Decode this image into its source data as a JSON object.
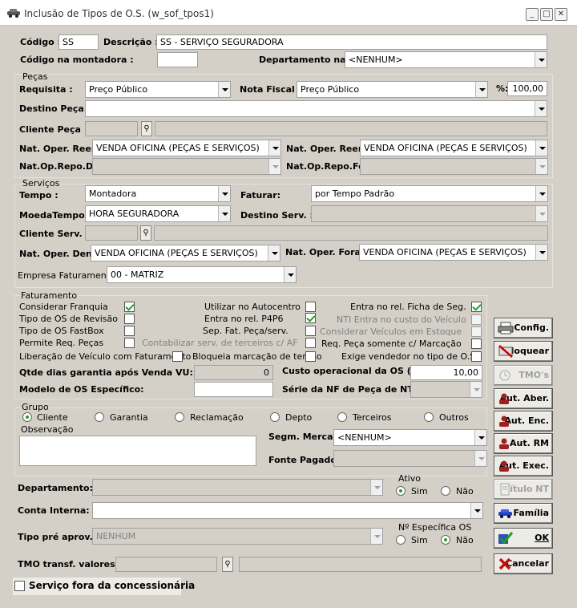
{
  "window": {
    "title": "Inclusão de Tipos de O.S. (w_sof_tpos1)",
    "min": "_",
    "max": "□",
    "close": "✕"
  },
  "codigo": {
    "label": "Código :",
    "value": "SS"
  },
  "descricao": {
    "label": "Descrição :",
    "value": "SS - SERVIÇO SEGURADORA"
  },
  "codigo_montadora": {
    "label": "Código na montadora :",
    "value": ""
  },
  "departamento_nf": {
    "label": "Departamento na NF:",
    "value": "<NENHUM>"
  },
  "pecas": {
    "group": "Peças",
    "requisita": {
      "label": "Requisita :",
      "value": "Preço Público"
    },
    "nota_fiscal": {
      "label": "Nota Fiscal :",
      "value": "Preço Público"
    },
    "percent": {
      "label": "%:",
      "value": "100,00"
    },
    "destino_peca": {
      "label": "Destino Peça :",
      "value": ""
    },
    "cliente_peca": {
      "label": "Cliente Peça :"
    },
    "nat_reem1": {
      "label": "Nat. Oper. Reem.",
      "value": "VENDA OFICINA (PEÇAS E SERVIÇOS)"
    },
    "nat_reem2": {
      "label": "Nat. Oper. Reem.",
      "value": "VENDA OFICINA (PEÇAS E SERVIÇOS)"
    },
    "nat_repo_den": {
      "label": "Nat.Op.Repo.Den:",
      "value": ""
    },
    "nat_repo_fora": {
      "label": "Nat.Op.Repo.Fora:",
      "value": ""
    }
  },
  "servicos": {
    "group": "Serviços",
    "tempo": {
      "label": "Tempo :",
      "value": "Montadora"
    },
    "faturar": {
      "label": "Faturar:",
      "value": "por Tempo Padrão"
    },
    "moeda": {
      "label": "MoedaTempo :",
      "value": "HORA SEGURADORA"
    },
    "destino_serv": {
      "label": "Destino Serv. :",
      "value": ""
    },
    "cliente_serv": {
      "label": "Cliente Serv. :"
    },
    "nat_dentro": {
      "label": "Nat. Oper. Dentro:",
      "value": "VENDA OFICINA (PEÇAS E SERVIÇOS)"
    },
    "nat_fora": {
      "label": "Nat. Oper. Fora:",
      "value": "VENDA OFICINA (PEÇAS E SERVIÇOS)"
    },
    "empresa": {
      "label": "Empresa Faturamento:",
      "value": "00 - MATRIZ"
    }
  },
  "faturamento": {
    "group": "Faturamento",
    "considerar_franquia": "Considerar Franquia",
    "tipo_revisao": "Tipo de OS de Revisão",
    "tipo_fastbox": "Tipo de OS FastBox",
    "permite_req": "Permite Req. Peças",
    "liberacao": "Liberação de Veículo com Faturamento",
    "autocentro": "Utilizar no Autocentro",
    "p4p6": "Entra no rel. P4P6",
    "sep_fat": "Sep. Fat. Peça/serv.",
    "contabilizar": "Contabilizar serv. de terceiros c/ AF",
    "bloqueia": "Bloqueia marcação de tempo",
    "ficha_seg": "Entra no rel. Ficha de Seg.",
    "nti_custo": "NTI Entra no custo do Veículo",
    "veic_estoque": "Considerar Veículos em Estoque",
    "req_peca": "Req. Peça somente c/ Marcação",
    "exige_vend": "Exige vendedor no tipo de O.S.",
    "qtde_dias": {
      "label": "Qtde dias garantia após Venda VU:",
      "value": "0"
    },
    "custo_op": {
      "label": "Custo operacional da OS (%)",
      "value": "10,00"
    },
    "modelo": {
      "label": "Modelo de OS Específico:",
      "value": ""
    },
    "serie": {
      "label": "Série da NF de Peça de NTI",
      "value": ""
    }
  },
  "grupo": {
    "label": "Grupo",
    "options": [
      "Cliente",
      "Garantia",
      "Reclamação",
      "Depto",
      "Terceiros",
      "Outros"
    ]
  },
  "observacao": {
    "label": "Observação",
    "value": ""
  },
  "segm": {
    "label": "Segm. Mercado:",
    "value": "<NENHUM>"
  },
  "fonte": {
    "label": "Fonte Pagadora:",
    "value": ""
  },
  "departamento": {
    "label": "Departamento:",
    "value": ""
  },
  "ativo": {
    "label": "Ativo",
    "sim": "Sim",
    "nao": "Não"
  },
  "conta": {
    "label": "Conta Interna:",
    "value": ""
  },
  "tipo_pre": {
    "label": "Tipo pré aprov.:",
    "value": "NENHUM"
  },
  "especifica": {
    "label": "Nº Específica OS",
    "sim": "Sim",
    "nao": "Não"
  },
  "tmo": {
    "label": "TMO transf. valores:"
  },
  "servico_fora": {
    "label": "Serviço fora da concessionária"
  },
  "buttons": {
    "config": "Config.",
    "bloquear": "Bloquear",
    "tmos": "TMO's",
    "aut_aber": "Aut. Aber.",
    "aut_enc": "Aut. Enc.",
    "aut_rm": "Aut. RM",
    "aut_exec": "Aut. Exec.",
    "titulo": "Título NT",
    "familia": "Família",
    "ok": "OK",
    "cancelar": "Cancelar"
  }
}
